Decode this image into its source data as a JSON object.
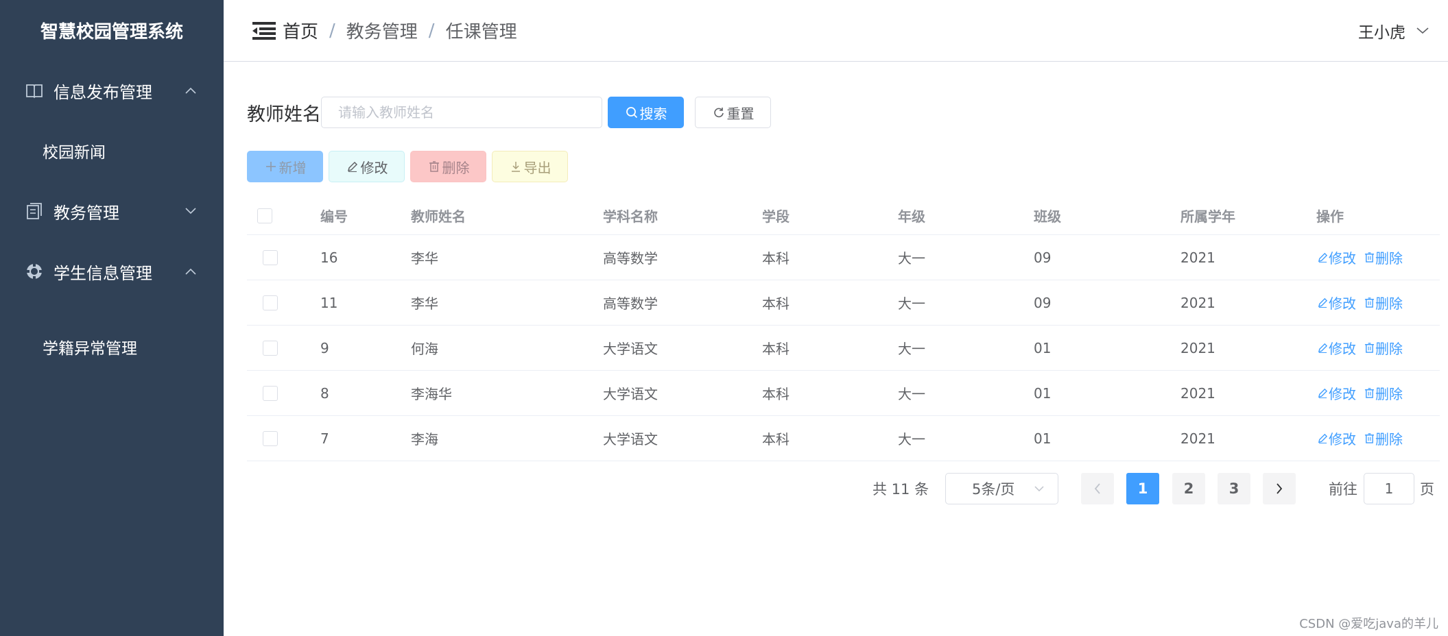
{
  "app": {
    "title": "智慧校园管理系统"
  },
  "sidebar": {
    "groups": [
      {
        "label": "信息发布管理",
        "icon": "book-icon",
        "expanded": true,
        "items": [
          {
            "label": "校园新闻"
          }
        ]
      },
      {
        "label": "教务管理",
        "icon": "document-icon",
        "expanded": false,
        "items": []
      },
      {
        "label": "学生信息管理",
        "icon": "badge-icon",
        "expanded": true,
        "items": [
          {
            "label": "学籍异常管理"
          }
        ]
      }
    ]
  },
  "header": {
    "breadcrumb": [
      "首页",
      "教务管理",
      "任课管理"
    ],
    "separator": "/",
    "user": "王小虎"
  },
  "search": {
    "label": "教师姓名",
    "placeholder": "请输入教师姓名",
    "value": "",
    "search_button": "搜索",
    "reset_button": "重置"
  },
  "toolbar": {
    "add": "新增",
    "edit": "修改",
    "delete": "删除",
    "export": "导出"
  },
  "table": {
    "columns": [
      "编号",
      "教师姓名",
      "学科名称",
      "学段",
      "年级",
      "班级",
      "所属学年",
      "操作"
    ],
    "rows": [
      {
        "id": "16",
        "teacher": "李华",
        "subject": "高等数学",
        "stage": "本科",
        "grade": "大一",
        "class": "09",
        "year": "2021"
      },
      {
        "id": "11",
        "teacher": "李华",
        "subject": "高等数学",
        "stage": "本科",
        "grade": "大一",
        "class": "09",
        "year": "2021"
      },
      {
        "id": "9",
        "teacher": "何海",
        "subject": "大学语文",
        "stage": "本科",
        "grade": "大一",
        "class": "01",
        "year": "2021"
      },
      {
        "id": "8",
        "teacher": "李海华",
        "subject": "大学语文",
        "stage": "本科",
        "grade": "大一",
        "class": "01",
        "year": "2021"
      },
      {
        "id": "7",
        "teacher": "李海",
        "subject": "大学语文",
        "stage": "本科",
        "grade": "大一",
        "class": "01",
        "year": "2021"
      }
    ],
    "row_actions": {
      "edit": "修改",
      "delete": "删除"
    }
  },
  "pagination": {
    "total_text": "共 11 条",
    "page_size": "5条/页",
    "pages": [
      "1",
      "2",
      "3"
    ],
    "current": "1",
    "goto_label": "前往",
    "goto_value": "1",
    "goto_suffix": "页"
  },
  "watermark": "CSDN @爱吃java的羊儿",
  "colors": {
    "sidebar_bg": "#304156",
    "primary": "#409eff",
    "add_btn": "#8cc5ff",
    "edit_btn": "#e8fbfb",
    "delete_btn": "#fcc7c7",
    "export_btn": "#fdfde0"
  }
}
